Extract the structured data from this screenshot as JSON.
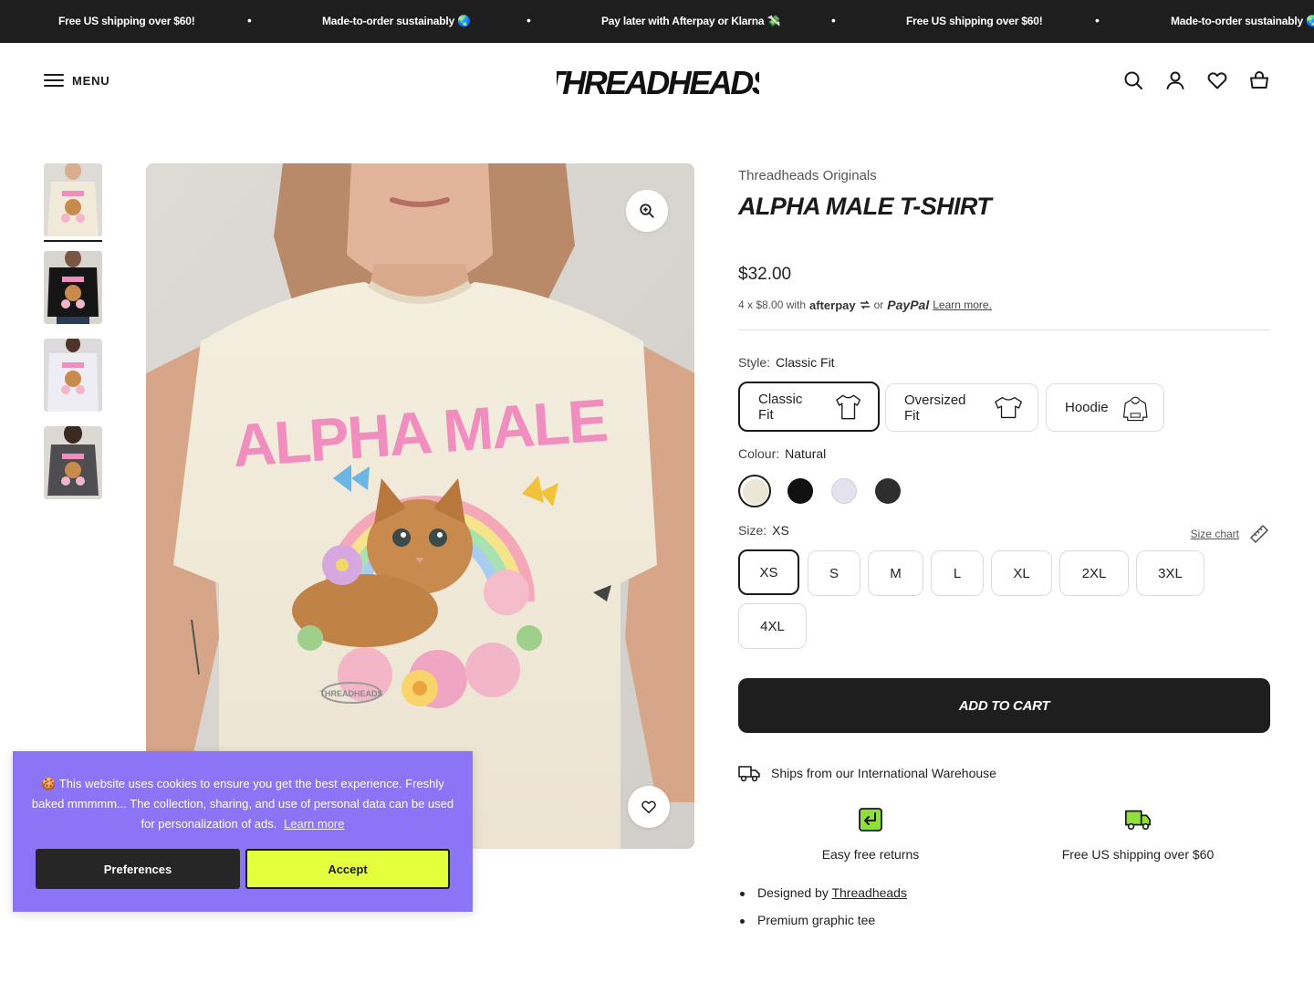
{
  "announcement": {
    "messages": [
      "Free US shipping over $60!",
      "Made-to-order sustainably 🌏",
      "Pay later with Afterpay or Klarna 💸",
      "Free US shipping over $60!",
      "Made-to-order sustainably 🌏"
    ],
    "separator": "•"
  },
  "header": {
    "menu_label": "MENU",
    "logo_text": "THREADHEADS",
    "icons": [
      "search-icon",
      "account-icon",
      "wishlist-icon",
      "cart-icon"
    ]
  },
  "gallery": {
    "thumbnails": [
      "natural",
      "black",
      "white",
      "charcoal"
    ],
    "active_index": 0,
    "print_text": "ALPHA MALE",
    "print_tag": "THREADHEADS"
  },
  "product": {
    "vendor": "Threadheads Originals",
    "title": "ALPHA MALE T-SHIRT",
    "price": "$32.00",
    "installment_prefix": "4 x $8.00 with",
    "afterpay": "afterpay",
    "or": "or",
    "paypal": "PayPal",
    "learn_more": "Learn more.",
    "style": {
      "label": "Style:",
      "selected": "Classic Fit",
      "options": [
        "Classic Fit",
        "Oversized Fit",
        "Hoodie"
      ]
    },
    "colour": {
      "label": "Colour:",
      "selected": "Natural",
      "swatches": [
        "#ede6d6",
        "#111111",
        "#e4e2ec",
        "#2e2e2e"
      ]
    },
    "size": {
      "label": "Size:",
      "selected": "XS",
      "size_chart": "Size chart",
      "options": [
        "XS",
        "S",
        "M",
        "L",
        "XL",
        "2XL",
        "3XL",
        "4XL"
      ]
    },
    "add_to_cart": "ADD TO CART",
    "ships_from": "Ships from our International Warehouse",
    "perks": [
      "Easy free returns",
      "Free US shipping over $60"
    ],
    "bullets": {
      "designed_by": "Designed by",
      "designer": "Threadheads",
      "second": "Premium graphic tee"
    }
  },
  "cookie": {
    "emoji": "🍪",
    "text": "This website uses cookies to ensure you get the best experience. Freshly baked mmmmm... The collection, sharing, and use of personal data can be used for personalization of ads.",
    "learn_more": "Learn more",
    "preferences": "Preferences",
    "accept": "Accept"
  },
  "colors": {
    "bar": "#1e1e1e",
    "cookie_bg": "#8b74f5",
    "accept_bg": "#e4ff3c",
    "print_pink": "#f08fbf",
    "perk_green": "#8fe03a"
  }
}
